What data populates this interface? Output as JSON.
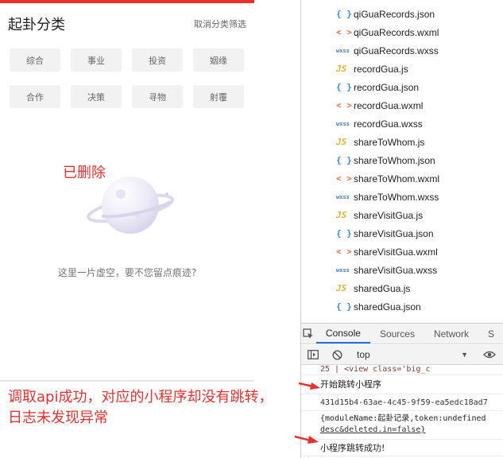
{
  "phone": {
    "title": "起卦分类",
    "cancel_label": "取消分类筛选",
    "categories": [
      "综合",
      "事业",
      "投资",
      "姻缘",
      "合作",
      "决策",
      "寻物",
      "射覆"
    ],
    "deleted_label": "已删除",
    "empty_text": "这里一片虚空，要不您留点痕迹?",
    "accent_color": "#e8302d"
  },
  "annotation": {
    "line1": "调取api成功，对应的小程序却没有跳转，",
    "line2": "日志未发现异常"
  },
  "devtools": {
    "files": [
      {
        "icon": "json",
        "icon_text": "{ }",
        "name": "qiGuaRecords.json"
      },
      {
        "icon": "wxml",
        "icon_text": "< >",
        "name": "qiGuaRecords.wxml"
      },
      {
        "icon": "wxss",
        "icon_text": "wxss",
        "name": "qiGuaRecords.wxss"
      },
      {
        "icon": "js",
        "icon_text": "JS",
        "name": "recordGua.js"
      },
      {
        "icon": "json",
        "icon_text": "{ }",
        "name": "recordGua.json"
      },
      {
        "icon": "wxml",
        "icon_text": "< >",
        "name": "recordGua.wxml"
      },
      {
        "icon": "wxss",
        "icon_text": "wxss",
        "name": "recordGua.wxss"
      },
      {
        "icon": "js",
        "icon_text": "JS",
        "name": "shareToWhom.js"
      },
      {
        "icon": "json",
        "icon_text": "{ }",
        "name": "shareToWhom.json"
      },
      {
        "icon": "wxml",
        "icon_text": "< >",
        "name": "shareToWhom.wxml"
      },
      {
        "icon": "wxss",
        "icon_text": "wxss",
        "name": "shareToWhom.wxss"
      },
      {
        "icon": "js",
        "icon_text": "JS",
        "name": "shareVisitGua.js"
      },
      {
        "icon": "json",
        "icon_text": "{ }",
        "name": "shareVisitGua.json"
      },
      {
        "icon": "wxml",
        "icon_text": "< >",
        "name": "shareVisitGua.wxml"
      },
      {
        "icon": "wxss",
        "icon_text": "wxss",
        "name": "shareVisitGua.wxss"
      },
      {
        "icon": "js",
        "icon_text": "JS",
        "name": "sharedGua.js"
      },
      {
        "icon": "json",
        "icon_text": "{ }",
        "name": "sharedGua.json"
      }
    ],
    "tabs": [
      "Console",
      "Sources",
      "Network",
      "S"
    ],
    "active_tab": "Console",
    "context": "top",
    "console": {
      "top_line": "25 |      <view class='big_c",
      "line1": "开始跳转小程序",
      "line2": "431d15b4-63ae-4c45-9f59-ea5edc18ad7",
      "line3a": "{moduleName:起卦记录,token:undefined",
      "line3b": "desc&deleted.in=false}",
      "line4": "小程序跳转成功!",
      "prompt": ">"
    }
  }
}
